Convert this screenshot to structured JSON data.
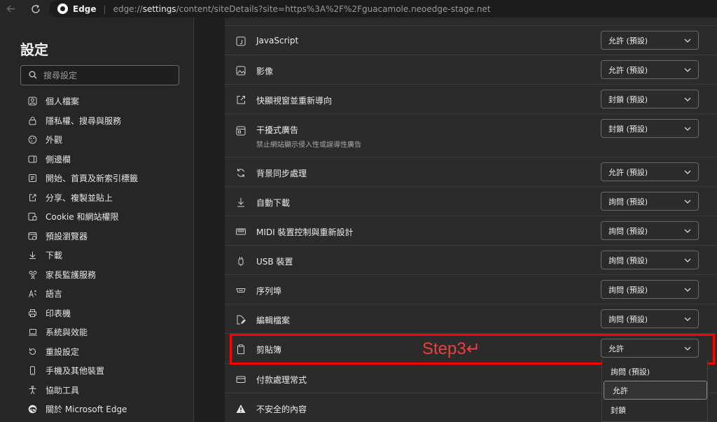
{
  "browser": {
    "name": "Edge",
    "url_prefix": "edge://",
    "url_path": "settings",
    "url_rest": "/content/siteDetails?site=https%3A%2F%2Fguacamole.neoedge-stage.net"
  },
  "sidebar": {
    "title": "設定",
    "search_placeholder": "搜尋設定",
    "items": [
      {
        "label": "個人檔案",
        "icon": "profile-icon"
      },
      {
        "label": "隱私權、搜尋與服務",
        "icon": "lock-icon"
      },
      {
        "label": "外觀",
        "icon": "palette-icon"
      },
      {
        "label": "側邊欄",
        "icon": "sidebar-icon"
      },
      {
        "label": "開始、首頁及新索引標籤",
        "icon": "home-icon"
      },
      {
        "label": "分享、複製並貼上",
        "icon": "share-icon"
      },
      {
        "label": "Cookie 和網站權限",
        "icon": "cookie-icon"
      },
      {
        "label": "預設瀏覽器",
        "icon": "browser-icon"
      },
      {
        "label": "下載",
        "icon": "download-icon"
      },
      {
        "label": "家長監護服務",
        "icon": "family-icon"
      },
      {
        "label": "語言",
        "icon": "language-icon"
      },
      {
        "label": "印表機",
        "icon": "printer-icon"
      },
      {
        "label": "系統與效能",
        "icon": "laptop-icon"
      },
      {
        "label": "重設設定",
        "icon": "reset-icon"
      },
      {
        "label": "手機及其他裝置",
        "icon": "phone-icon"
      },
      {
        "label": "協助工具",
        "icon": "accessibility-icon"
      },
      {
        "label": "關於 Microsoft Edge",
        "icon": "edge-icon"
      }
    ]
  },
  "permissions": [
    {
      "label": "JavaScript",
      "value": "允許 (預設)",
      "icon": "javascript-icon"
    },
    {
      "label": "影像",
      "value": "允許 (預設)",
      "icon": "image-icon"
    },
    {
      "label": "快顯視窗並重新導向",
      "value": "封鎖 (預設)",
      "icon": "popup-icon"
    },
    {
      "label": "干擾式廣告",
      "desc": "禁止網站顯示侵入性或誤導性廣告",
      "value": "封鎖 (預設)",
      "icon": "ads-icon"
    },
    {
      "label": "背景同步處理",
      "value": "允許 (預設)",
      "icon": "sync-icon"
    },
    {
      "label": "自動下載",
      "value": "詢問 (預設)",
      "icon": "download-icon"
    },
    {
      "label": "MIDI 裝置控制與重新設計",
      "value": "詢問 (預設)",
      "icon": "midi-icon"
    },
    {
      "label": "USB 裝置",
      "value": "詢問 (預設)",
      "icon": "usb-icon"
    },
    {
      "label": "序列埠",
      "value": "詢問 (預設)",
      "icon": "serial-port-icon"
    },
    {
      "label": "編輯檔案",
      "value": "詢問 (預設)",
      "icon": "edit-file-icon"
    },
    {
      "label": "剪貼簿",
      "value": "允許",
      "icon": "clipboard-icon"
    },
    {
      "label": "付款處理常式",
      "icon": "payment-icon"
    },
    {
      "label": "不安全的內容",
      "icon": "warning-icon"
    }
  ],
  "annotation": {
    "step_label": "Step3↵",
    "highlight_color": "#ff0000"
  },
  "dropdown": {
    "options": [
      "詢問 (預設)",
      "允許",
      "封鎖"
    ],
    "selected": "允許"
  }
}
